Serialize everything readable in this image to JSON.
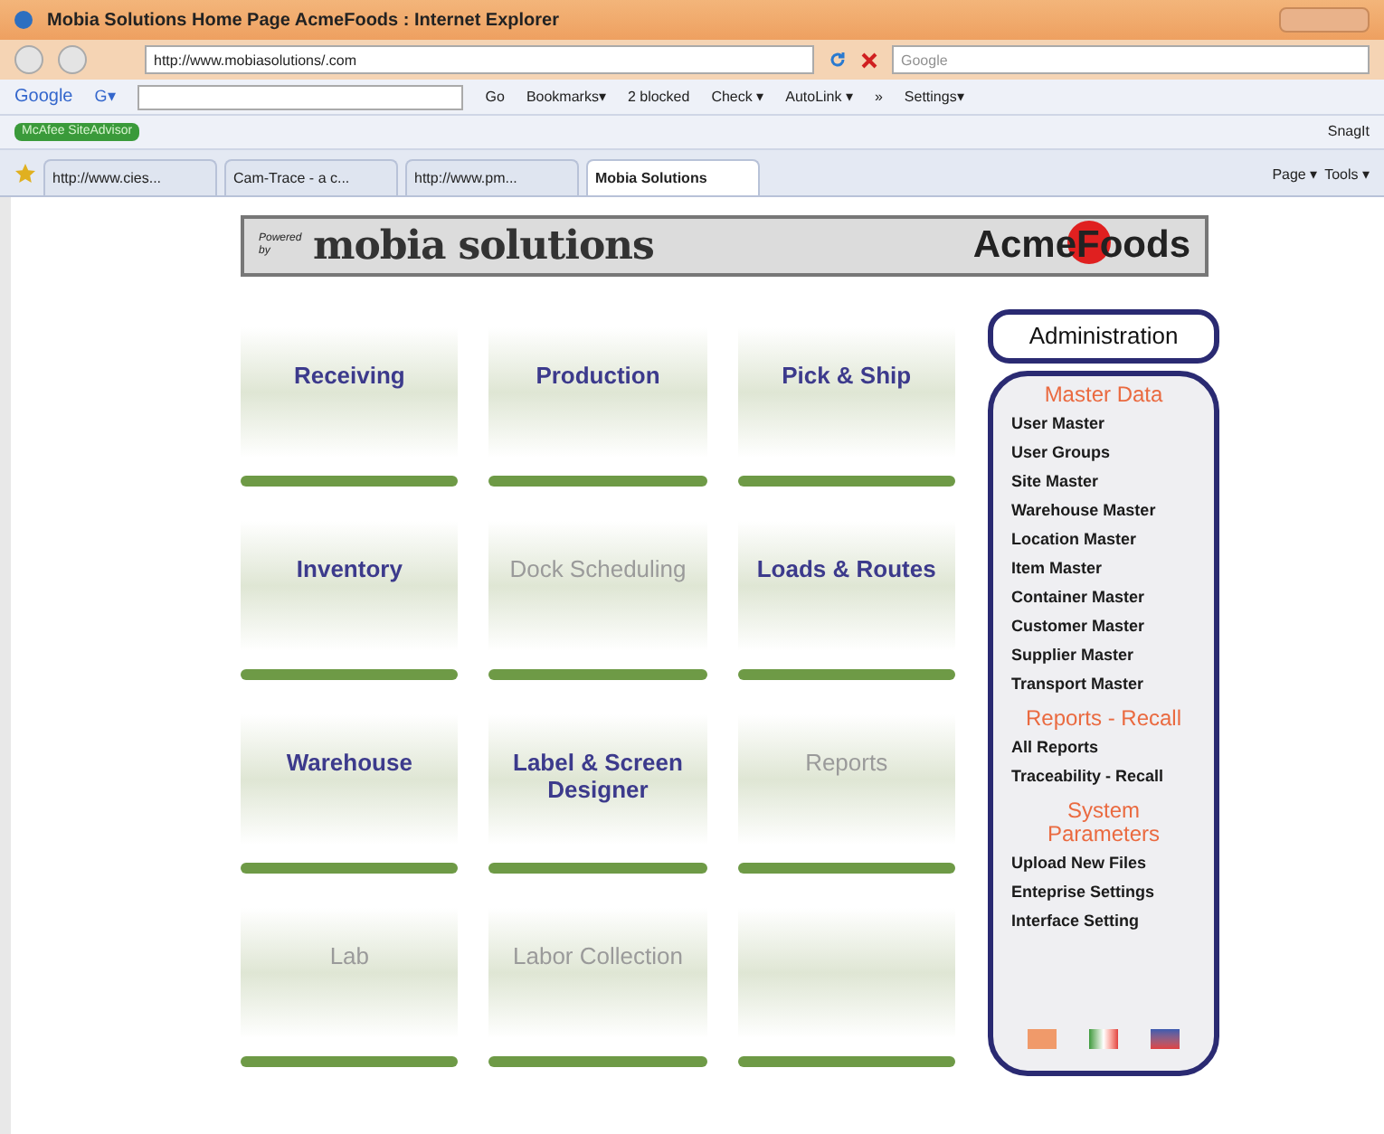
{
  "window": {
    "title": "Mobia Solutions Home Page AcmeFoods : Internet Explorer"
  },
  "address_bar": {
    "value": "http://www.mobiasolutions/.com"
  },
  "search": {
    "placeholder": "Google"
  },
  "google_toolbar": {
    "logo": "Google",
    "menu": "G▾",
    "go": "Go",
    "items": [
      "Bookmarks▾",
      "2 blocked",
      "Check ▾",
      "AutoLink ▾",
      "»",
      "Settings▾"
    ]
  },
  "links_bar": {
    "siteadvisor": "McAfee SiteAdvisor",
    "snagit": "SnagIt"
  },
  "tabs": [
    {
      "label": "http://www.cies...",
      "selected": false
    },
    {
      "label": "Cam-Trace - a c...",
      "selected": false
    },
    {
      "label": "http://www.pm...",
      "selected": false
    },
    {
      "label": "Mobia Solutions",
      "selected": true
    }
  ],
  "command_bar": [
    "Page ▾",
    "Tools ▾"
  ],
  "banner": {
    "powered_by": "Powered by",
    "brand": "mobia solutions",
    "client": "AcmeFoods"
  },
  "tiles": [
    {
      "kind": "module",
      "label": "Receiving",
      "enabled": true
    },
    {
      "kind": "module",
      "label": "Production",
      "enabled": true
    },
    {
      "kind": "module",
      "label": "Pick & Ship",
      "enabled": true
    },
    {
      "kind": "module",
      "label": "Inventory",
      "enabled": true
    },
    {
      "kind": "module",
      "label": "Dock Scheduling",
      "enabled": false
    },
    {
      "kind": "module",
      "label": "Loads & Routes",
      "enabled": true
    },
    {
      "kind": "module",
      "label": "Warehouse",
      "enabled": true
    },
    {
      "kind": "module",
      "label": "Label & Screen Designer",
      "enabled": true
    },
    {
      "kind": "module",
      "label": "Reports",
      "enabled": false
    },
    {
      "kind": "module",
      "label": "Lab",
      "enabled": false
    },
    {
      "kind": "module",
      "label": "Labor Collection",
      "enabled": false
    },
    {
      "kind": "blank"
    }
  ],
  "sidebar": {
    "title": "Administration",
    "sections": [
      {
        "heading": "Master Data",
        "items": [
          "User Master",
          "User Groups",
          "Site Master",
          "Warehouse Master",
          "Location Master",
          "Item Master",
          "Container Master",
          "Customer Master",
          "Supplier Master",
          "Transport Master"
        ]
      },
      {
        "heading": "Reports - Recall",
        "items": [
          "All Reports",
          "Traceability - Recall"
        ]
      },
      {
        "heading": "System Parameters",
        "items": [
          "Upload New Files",
          "Enteprise Settings",
          "Interface Setting"
        ]
      }
    ]
  }
}
